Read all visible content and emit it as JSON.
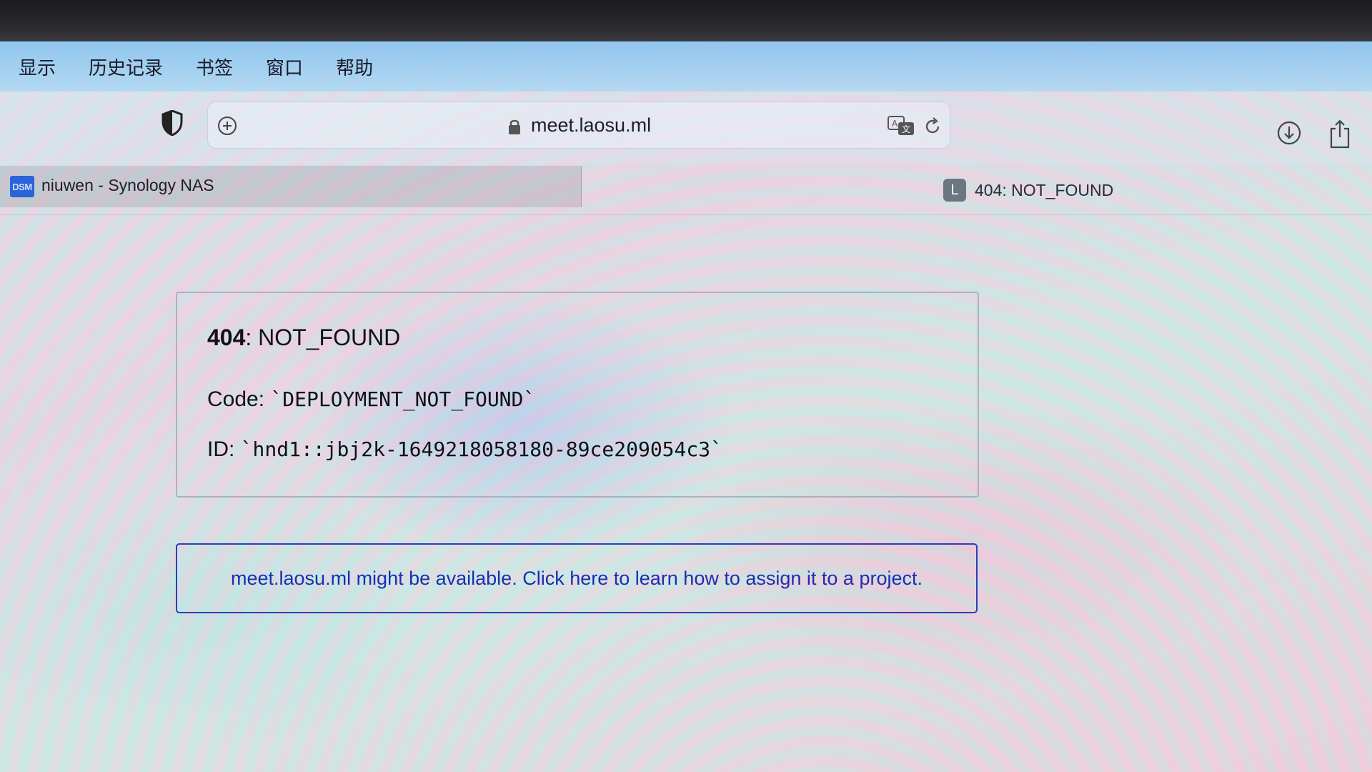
{
  "menubar": {
    "items": [
      "显示",
      "历史记录",
      "书签",
      "窗口",
      "帮助"
    ]
  },
  "toolbar": {
    "url": "meet.laosu.ml"
  },
  "tabs": [
    {
      "title": "niuwen - Synology NAS",
      "icon_text": "DSM",
      "active": false
    },
    {
      "title": "404: NOT_FOUND",
      "icon_text": "L",
      "active": true
    }
  ],
  "error": {
    "status_code": "404",
    "status_text": ": NOT_FOUND",
    "code_label": "Code: ",
    "code_value": "`DEPLOYMENT_NOT_FOUND`",
    "id_label": "ID: ",
    "id_value": "`hnd1::jbj2k-1649218058180-89ce209054c3`"
  },
  "notice": {
    "text": "meet.laosu.ml might be available. Click here to learn how to assign it to a project."
  },
  "colors": {
    "link": "#1a2fb0",
    "notice_border": "#2a3fb8",
    "menubar": "#8ec8f0"
  },
  "icons": [
    "shield-icon",
    "new-tab-icon",
    "lock-icon",
    "translate-icon",
    "reload-icon",
    "download-icon",
    "share-icon"
  ]
}
